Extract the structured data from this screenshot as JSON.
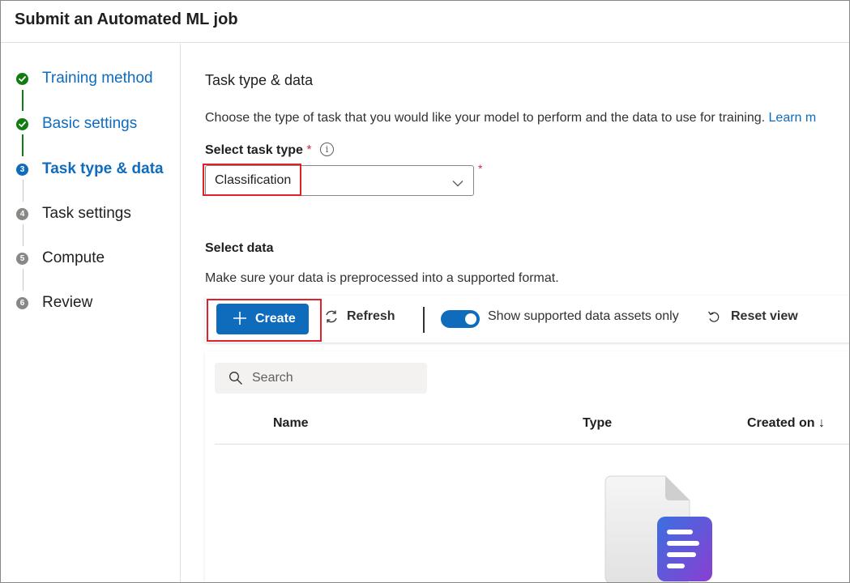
{
  "window": {
    "title": "Submit an Automated ML job"
  },
  "steps": [
    {
      "label": "Training method",
      "state": "done",
      "marker": ""
    },
    {
      "label": "Basic settings",
      "state": "done",
      "marker": ""
    },
    {
      "label": "Task type & data",
      "state": "current",
      "marker": "3"
    },
    {
      "label": "Task settings",
      "state": "todo",
      "marker": "4"
    },
    {
      "label": "Compute",
      "state": "todo",
      "marker": "5"
    },
    {
      "label": "Review",
      "state": "todo",
      "marker": "6"
    }
  ],
  "task": {
    "section_title": "Task type & data",
    "description": "Choose the type of task that you would like your model to perform and the data to use for training.",
    "learn_more": "Learn m",
    "field_label": "Select task type",
    "required_mark": "*",
    "info_glyph": "i",
    "selected_value": "Classification"
  },
  "data": {
    "section_title": "Select data",
    "description": "Make sure your data is preprocessed into a supported format.",
    "toolbar": {
      "create_label": "Create",
      "refresh_label": "Refresh",
      "toggle_label": "Show supported data assets only",
      "toggle_on": true,
      "reset_label": "Reset view"
    },
    "search": {
      "placeholder": "Search",
      "value": ""
    },
    "columns": {
      "name": "Name",
      "type": "Type",
      "created_on": "Created on ↓"
    }
  },
  "colors": {
    "accent": "#0f6cbd",
    "done": "#107c10",
    "todo": "#8a8886",
    "required": "#c4314b",
    "highlight": "#e0202a"
  },
  "icons": {
    "done_step": "checkmark-icon",
    "dropdown": "chevron-down-icon",
    "create": "plus-icon",
    "refresh": "refresh-icon",
    "reset": "undo-icon",
    "search": "search-icon",
    "empty_state": "document-icon"
  }
}
